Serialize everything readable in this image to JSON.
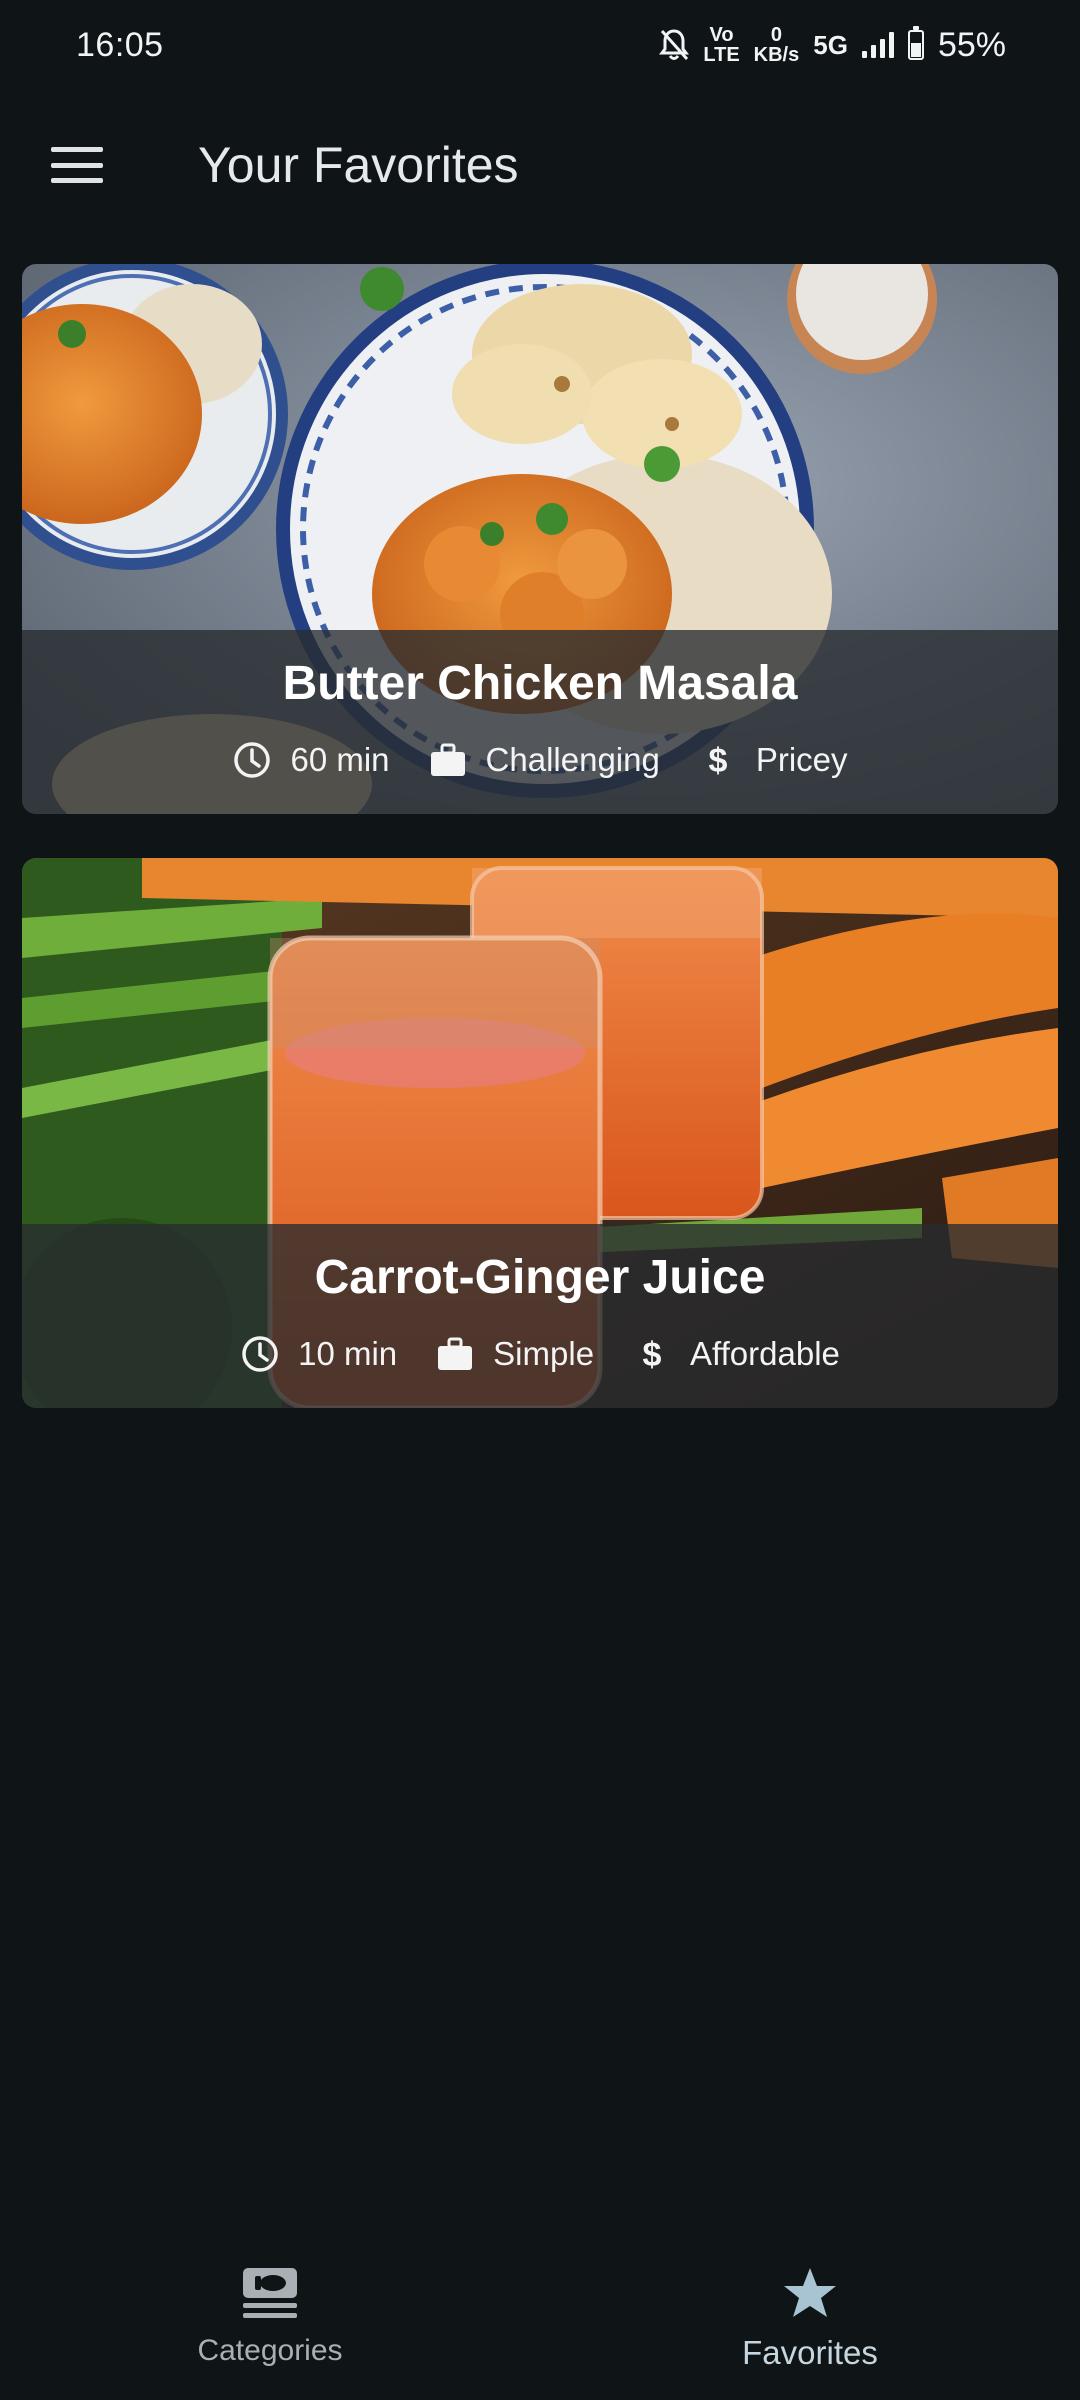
{
  "status_bar": {
    "time": "16:05",
    "volte_top": "Vo",
    "volte_bottom": "LTE",
    "speed_value": "0",
    "speed_unit": "KB/s",
    "network": "5G",
    "battery": "55%",
    "icons": [
      "mute-bell-icon",
      "volte-icon",
      "signal-icon",
      "battery-icon"
    ]
  },
  "app_bar": {
    "title": "Your Favorites",
    "menu_icon": "hamburger-menu-icon"
  },
  "meals": [
    {
      "title": "Butter Chicken Masala",
      "duration": "60 min",
      "complexity": "Challenging",
      "affordability": "Pricey"
    },
    {
      "title": "Carrot-Ginger Juice",
      "duration": "10 min",
      "complexity": "Simple",
      "affordability": "Affordable"
    }
  ],
  "bottom_nav": {
    "items": [
      {
        "label": "Categories",
        "icon": "meal-set-icon",
        "active": false
      },
      {
        "label": "Favorites",
        "icon": "star-icon",
        "active": true
      }
    ]
  },
  "colors": {
    "background": "#0f1417",
    "overlay": "#282c30",
    "active_nav": "#c5d6df"
  }
}
